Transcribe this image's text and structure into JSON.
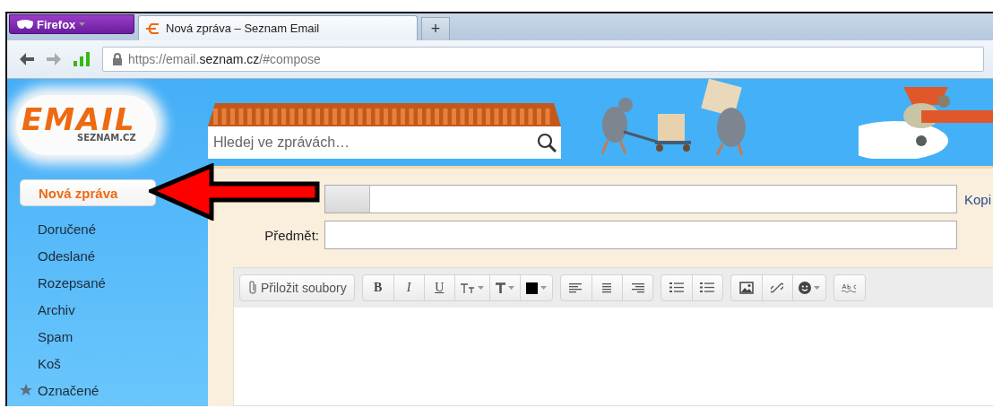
{
  "browser": {
    "menu_button": "Firefox",
    "tabs": [
      {
        "title": "Nová zpráva – Seznam Email",
        "selected": true
      }
    ],
    "new_tab": "+",
    "url": {
      "scheme": "https://email.",
      "domain": "seznam.cz",
      "path": "/#compose"
    }
  },
  "logo": {
    "word": "EMAIL",
    "sub": "SEZNAM.CZ"
  },
  "search": {
    "placeholder": "Hledej ve zprávách…"
  },
  "sidebar": {
    "compose_button": "Nová zpráva",
    "folders": [
      {
        "label": "Doručené",
        "starred": false
      },
      {
        "label": "Odeslané",
        "starred": false
      },
      {
        "label": "Rozepsané",
        "starred": false
      },
      {
        "label": "Archiv",
        "starred": false
      },
      {
        "label": "Spam",
        "starred": false
      },
      {
        "label": "Koš",
        "starred": false
      },
      {
        "label": "Označené",
        "starred": true
      }
    ]
  },
  "compose": {
    "to_link": "Kopi",
    "subject_label": "Předmět:",
    "toolbar": [
      [
        {
          "kind": "attach",
          "label": "Přiložit soubory"
        }
      ],
      [
        {
          "kind": "bold",
          "label": "B"
        },
        {
          "kind": "italic",
          "label": "I"
        },
        {
          "kind": "underline",
          "label": "U"
        },
        {
          "kind": "size"
        },
        {
          "kind": "font"
        },
        {
          "kind": "color",
          "color": "#000000"
        }
      ],
      [
        {
          "kind": "alignleft"
        },
        {
          "kind": "aligncenter"
        },
        {
          "kind": "alignright"
        }
      ],
      [
        {
          "kind": "numbered"
        },
        {
          "kind": "bulleted"
        }
      ],
      [
        {
          "kind": "image"
        },
        {
          "kind": "link"
        },
        {
          "kind": "emoji"
        }
      ],
      [
        {
          "kind": "spell"
        }
      ]
    ]
  }
}
